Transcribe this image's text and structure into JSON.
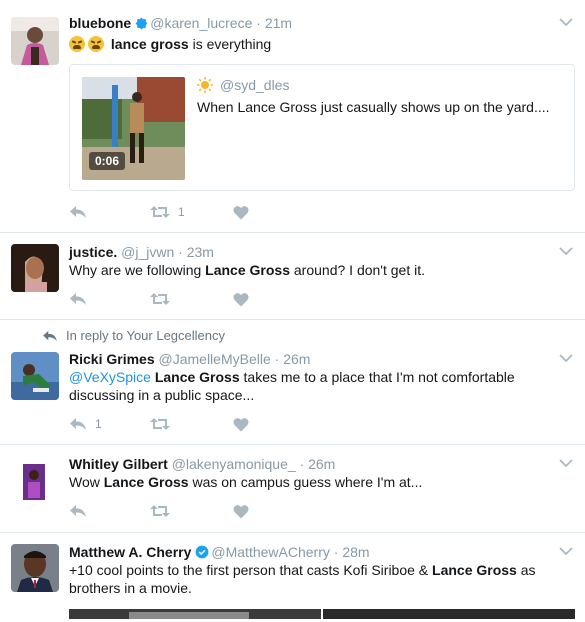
{
  "tweets": [
    {
      "name": "bluebone",
      "handle": "@karen_lucrece",
      "time": "21m",
      "text_bold": "lance gross",
      "text_after": " is everything",
      "quote": {
        "handle": "@syd_dles",
        "text": "When Lance Gross just casually shows up on the yard....",
        "duration": "0:06"
      },
      "retweets": "1"
    },
    {
      "name": "justice.",
      "handle": "@j_jvwn",
      "time": "23m",
      "text_before": "Why are we following ",
      "text_bold": "Lance Gross",
      "text_after": " around? I don't get it."
    },
    {
      "context": "In reply to Your Legcellency",
      "name": "Ricki Grimes",
      "handle": "@JamelleMyBelle",
      "time": "26m",
      "mention": "@VeXySpice",
      "text_bold": "Lance Gross",
      "text_line1_after": " takes me to a place that I'm not comfortable",
      "text_line2": "discussing in a public space...",
      "replies": "1"
    },
    {
      "name": "Whitley Gilbert",
      "handle": "@lakenyamonique_",
      "time": "26m",
      "text_before": "Wow ",
      "text_bold": "Lance Gross",
      "text_after": " was on campus guess where I'm at..."
    },
    {
      "name": "Matthew A. Cherry",
      "handle": "@MatthewACherry",
      "time": "28m",
      "text_line1_before": "+10 cool points to the first person that casts Kofi Siriboe & ",
      "text_bold": "Lance Gross",
      "text_line1_after": " as",
      "text_line2": "brothers in a movie."
    }
  ],
  "separator": "·",
  "colors": {
    "link": "#1b95e0",
    "muted": "#8899a6",
    "border": "#e1e8ed",
    "retweet_icon": "#aab8c2"
  },
  "icons": [
    "reply-icon",
    "retweet-icon",
    "like-icon",
    "chevron-down-icon",
    "verified-badge-icon",
    "sun-emoji-icon",
    "weary-face-emoji"
  ]
}
